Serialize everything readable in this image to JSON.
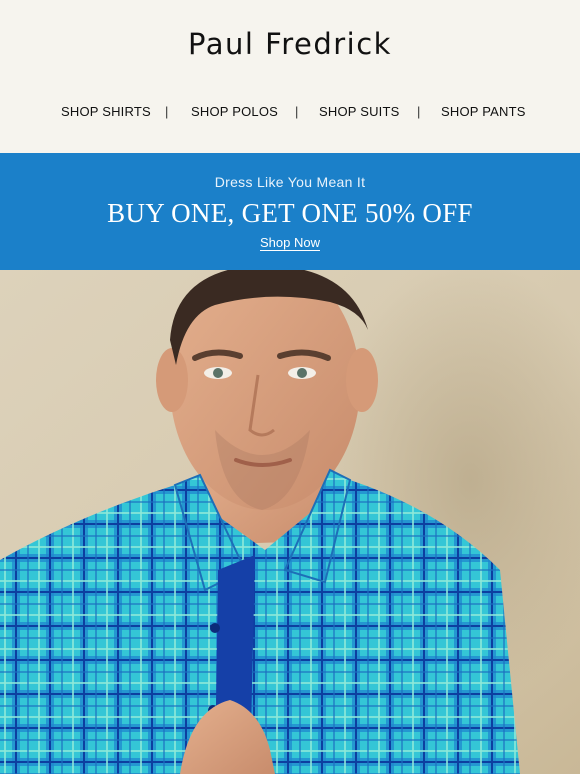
{
  "header": {
    "logo_text": "Paul Fredrick",
    "nav": [
      {
        "label": "SHOP SHIRTS"
      },
      {
        "label": "SHOP POLOS"
      },
      {
        "label": "SHOP SUITS"
      },
      {
        "label": "SHOP PANTS"
      }
    ],
    "separator": "|"
  },
  "banner": {
    "eyebrow": "Dress Like You Mean It",
    "headline": "BUY ONE, GET ONE 50% OFF",
    "cta": "Shop Now",
    "background_color": "#1b80c9"
  },
  "hero": {
    "image_subject": "man-in-turquoise-plaid-shirt"
  }
}
